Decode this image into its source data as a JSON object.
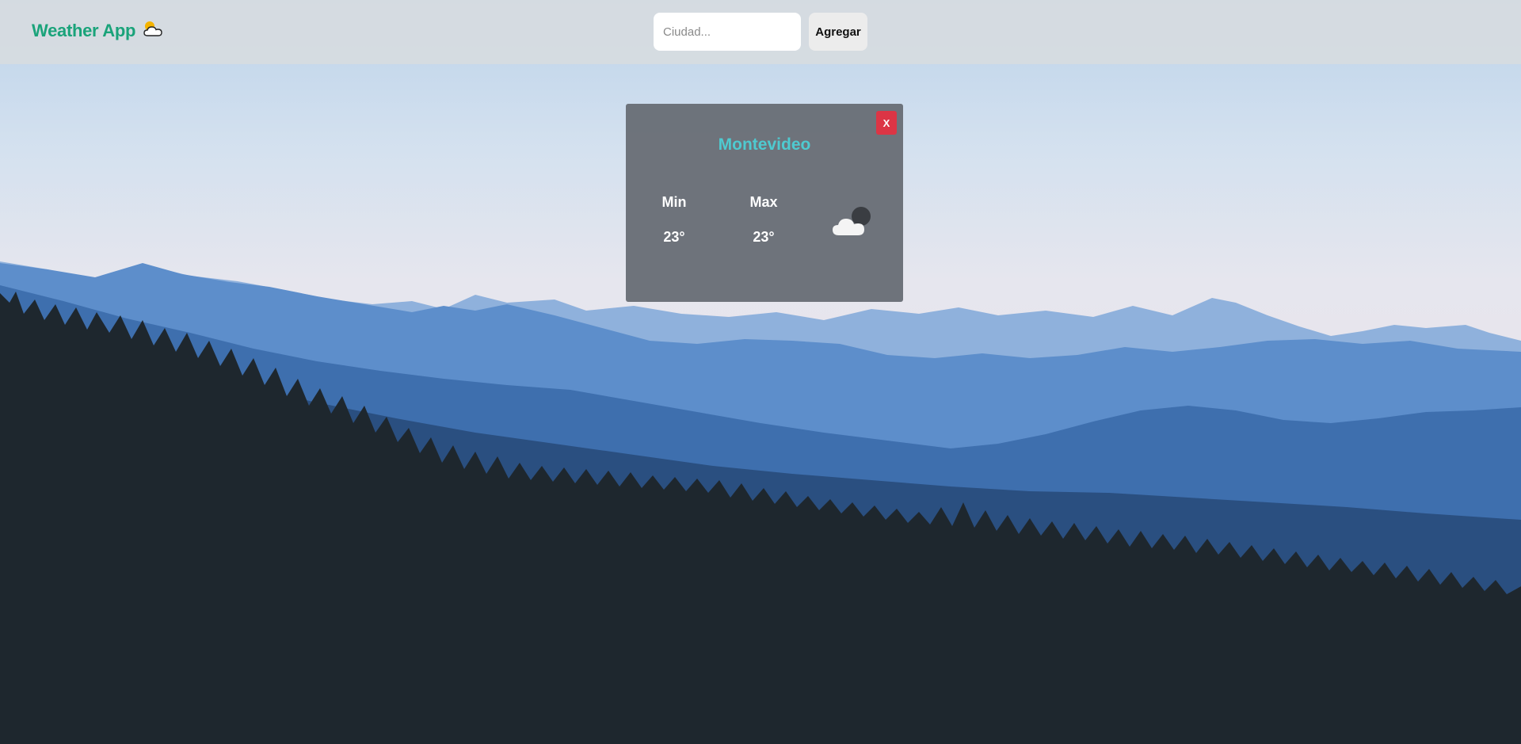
{
  "header": {
    "app_title": "Weather App",
    "brand_icon": "sun-behind-cloud-icon",
    "search": {
      "value": "",
      "placeholder": "Ciudad..."
    },
    "add_label": "Agregar"
  },
  "card": {
    "close_label": "X",
    "city": "Montevideo",
    "min_label": "Min",
    "min_value": "23°",
    "max_label": "Max",
    "max_value": "23°",
    "weather_icon": "cloud-night-icon"
  },
  "colors": {
    "brand": "#1aa37a",
    "city": "#4ecad0",
    "close": "#dc3545",
    "card_bg": "#696e76"
  }
}
